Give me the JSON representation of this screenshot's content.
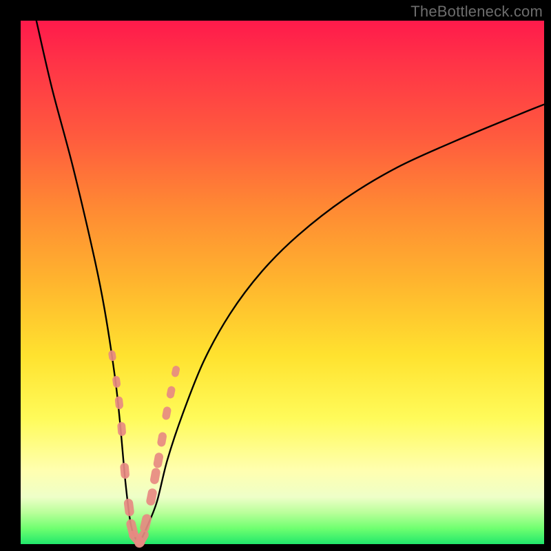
{
  "watermark": {
    "text": "TheBottleneck.com"
  },
  "chart_data": {
    "type": "line",
    "title": "",
    "xlabel": "",
    "ylabel": "",
    "xlim": [
      0,
      100
    ],
    "ylim": [
      0,
      100
    ],
    "series": [
      {
        "name": "bottleneck-curve",
        "x": [
          3,
          6,
          10,
          14,
          16,
          18,
          19,
          20,
          21,
          22,
          23,
          24,
          26,
          28,
          31,
          35,
          40,
          46,
          53,
          62,
          72,
          83,
          95,
          100
        ],
        "values": [
          100,
          87,
          72,
          55,
          45,
          32,
          23,
          12,
          4,
          1,
          1,
          3,
          8,
          16,
          25,
          35,
          44,
          52,
          59,
          66,
          72,
          77,
          82,
          84
        ]
      }
    ],
    "markers": {
      "name": "highlight-points",
      "x": [
        17.5,
        18.3,
        18.8,
        19.3,
        19.9,
        20.7,
        21.3,
        22.2,
        23.1,
        23.9,
        25.0,
        25.7,
        26.3,
        27.0,
        27.9,
        28.7,
        29.6
      ],
      "values": [
        36,
        31,
        27,
        22,
        14,
        7,
        3,
        1,
        1,
        4,
        9,
        13,
        16,
        20,
        25,
        29,
        33
      ]
    },
    "background_gradient": {
      "stops": [
        {
          "pos": 0.0,
          "color": "#ff1a4b"
        },
        {
          "pos": 0.36,
          "color": "#ff8a33"
        },
        {
          "pos": 0.64,
          "color": "#ffe22f"
        },
        {
          "pos": 0.86,
          "color": "#ffffb0"
        },
        {
          "pos": 1.0,
          "color": "#21e86b"
        }
      ]
    }
  }
}
